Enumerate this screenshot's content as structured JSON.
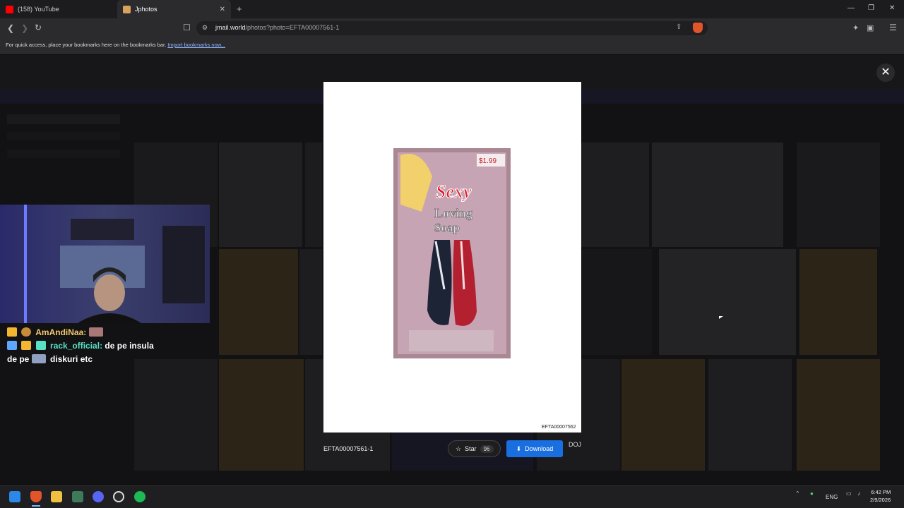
{
  "browser": {
    "tabs": [
      {
        "label": "(158) YouTube",
        "color": "#ff0000"
      },
      {
        "label": "Jphotos",
        "color": "#d9a35b"
      }
    ],
    "new_tab_symbol": "+",
    "url_domain": "jmail.world",
    "url_path": "/photos?photo=EFTA00007561-1",
    "bookmarks_hint": "For quick access, place your bookmarks here on the bookmarks bar.",
    "bookmarks_link": "Import bookmarks now..."
  },
  "modal": {
    "photo_id_caption": "EFTA00007562",
    "file_label": "EFTA00007561-1",
    "star_label": "Star",
    "star_count": "96",
    "download_label": "Download",
    "source_label": "DOJ",
    "close_symbol": "✕",
    "photo_text": {
      "price": "$1.99",
      "line1": "Sexy",
      "line2": "Loving",
      "line3": "Soap"
    }
  },
  "chat": {
    "msg1_user": "AmAndiNaa:",
    "msg2_user": "rack_official:",
    "msg2_text_a": "de pe insula",
    "msg2_text_b": "de pe",
    "msg2_text_c": "diskuri etc"
  },
  "taskbar": {
    "language": "ENG",
    "time": "6:42 PM",
    "date": "2/9/2026"
  },
  "colors": {
    "accent_blue": "#1a6fe0",
    "modal_bg": "#ffffff",
    "page_bg": "#121214"
  }
}
